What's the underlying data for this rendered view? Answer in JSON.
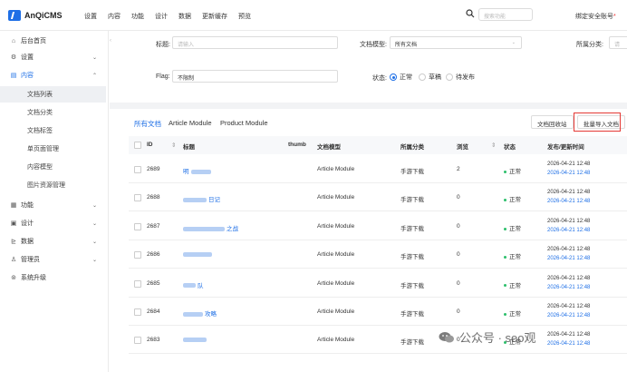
{
  "app": {
    "logo_text": "AnQiCMS"
  },
  "topnav": [
    "设置",
    "内容",
    "功能",
    "设计",
    "数据",
    "更新缓存",
    "预览"
  ],
  "search": {
    "placeholder": "搜索功能"
  },
  "top_right": {
    "text": "绑定安全账号",
    "marker": "*"
  },
  "sidebar": {
    "items": [
      {
        "label": "后台首页",
        "icon": "home-icon",
        "glyph": "⌂",
        "chev": ""
      },
      {
        "label": "设置",
        "icon": "gear-icon",
        "glyph": "⚙",
        "chev": "⌄"
      },
      {
        "label": "内容",
        "icon": "content-icon",
        "glyph": "▤",
        "chev": "⌃"
      }
    ],
    "sub_items": [
      "文档列表",
      "文档分类",
      "文档标签",
      "单页面管理",
      "内容模型",
      "图片资源管理"
    ],
    "more_items": [
      {
        "label": "功能",
        "icon": "apps-icon",
        "glyph": "▦",
        "chev": "⌄"
      },
      {
        "label": "设计",
        "icon": "design-icon",
        "glyph": "▣",
        "chev": "⌄"
      },
      {
        "label": "数据",
        "icon": "chart-icon",
        "glyph": "⊵",
        "chev": "⌄"
      },
      {
        "label": "管理员",
        "icon": "user-icon",
        "glyph": "♙",
        "chev": "⌄"
      },
      {
        "label": "系统升级",
        "icon": "upgrade-icon",
        "glyph": "⊚",
        "chev": ""
      }
    ]
  },
  "filters": {
    "title_label": "标题:",
    "title_placeholder": "请输入",
    "model_label": "文档模型:",
    "model_value": "所有文档",
    "category_label": "所属分类:",
    "category_value": "请",
    "flag_label": "Flag:",
    "flag_value": "不限制",
    "status_label": "状态:",
    "status_options": [
      "正常",
      "草稿",
      "待发布"
    ]
  },
  "tabs": [
    "所有文档",
    "Article Module",
    "Product Module"
  ],
  "buttons": {
    "recycle": "文档回收站",
    "import": "批量导入文档"
  },
  "table": {
    "headers": {
      "id": "ID",
      "title": "标题",
      "thumb": "thumb",
      "model": "文档模型",
      "category": "所属分类",
      "views": "浏览",
      "status": "状态",
      "time": "发布/更新时间"
    },
    "rows": [
      {
        "id": "2689",
        "title_visible": "明",
        "model": "Article Module",
        "category": "手游下载",
        "views": "2",
        "status": "正常",
        "published": "2026-04-21 12:48",
        "updated": "2026-04-21 12:48"
      },
      {
        "id": "2688",
        "title_visible": "日记",
        "model": "Article Module",
        "category": "手游下载",
        "views": "0",
        "status": "正常",
        "published": "2026-04-21 12:48",
        "updated": "2026-04-21 12:48"
      },
      {
        "id": "2687",
        "title_visible": "之战",
        "model": "Article Module",
        "category": "手游下载",
        "views": "0",
        "status": "正常",
        "published": "2026-04-21 12:48",
        "updated": "2026-04-21 12:48"
      },
      {
        "id": "2686",
        "title_visible": "",
        "model": "Article Module",
        "category": "手游下载",
        "views": "0",
        "status": "正常",
        "published": "2026-04-21 12:48",
        "updated": "2026-04-21 12:48"
      },
      {
        "id": "2685",
        "title_visible": "队",
        "model": "Article Module",
        "category": "手游下载",
        "views": "0",
        "status": "正常",
        "published": "2026-04-21 12:48",
        "updated": "2026-04-21 12:48"
      },
      {
        "id": "2684",
        "title_visible": "攻略",
        "model": "Article Module",
        "category": "手游下载",
        "views": "0",
        "status": "正常",
        "published": "2026-04-21 12:48",
        "updated": "2026-04-21 12:48"
      },
      {
        "id": "2683",
        "title_visible": "",
        "model": "Article Module",
        "category": "手游下载",
        "views": "0",
        "status": "正常",
        "published": "2026-04-21 12:48",
        "updated": "2026-04-21 12:48"
      }
    ]
  },
  "watermark": {
    "text": "公众号 · seo观"
  },
  "colors": {
    "accent": "#1e6fe6",
    "status_ok": "#2dbf6c",
    "highlight": "#e53935"
  }
}
